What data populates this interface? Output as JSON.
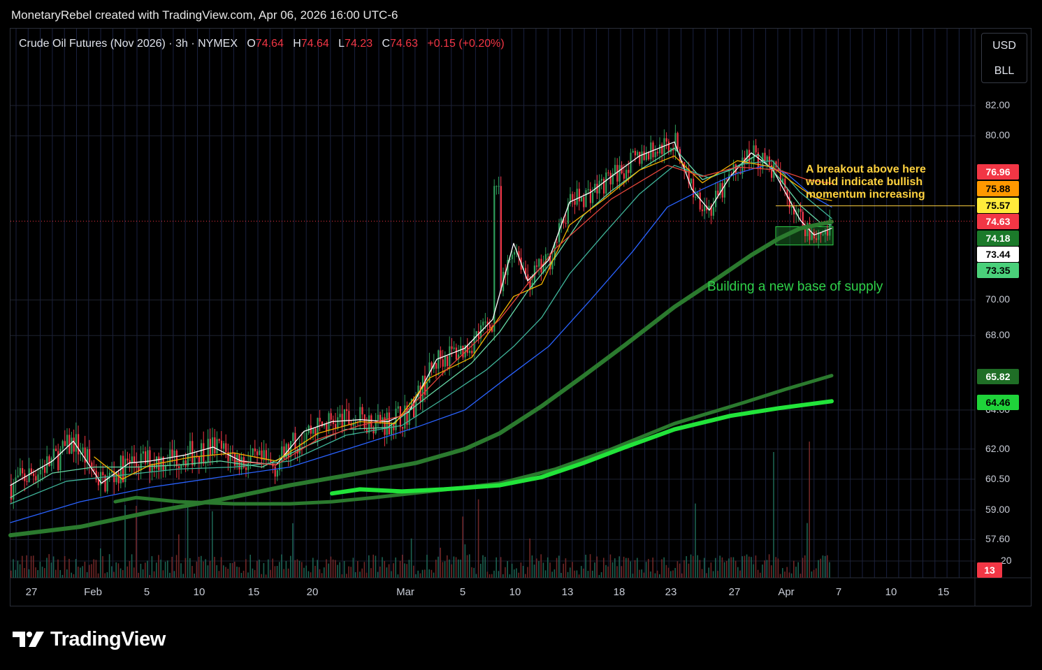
{
  "header": {
    "text": "MonetaryRebel created with TradingView.com, Apr 06, 2026 16:00 UTC-6"
  },
  "legend": {
    "symbol": "Crude Oil Futures (Nov 2026) · 3h · NYMEX",
    "open_label": "O",
    "open": "74.64",
    "high_label": "H",
    "high": "74.64",
    "low_label": "L",
    "low": "74.23",
    "close_label": "C",
    "close": "74.63",
    "change": "+0.15 (+0.20%)"
  },
  "currency": {
    "line1": "USD",
    "line2": "BLL"
  },
  "brand": {
    "name": "TradingView"
  },
  "annotations": {
    "breakout": [
      "A breakout above here",
      "would indicate bullish",
      "momentum increasing"
    ],
    "base": "Building a new base of supply"
  },
  "colors": {
    "background": "#000000",
    "up": "#2e9e5b",
    "down": "#f23645",
    "ema_white": "#ffffff",
    "ema_green_light": "#66d9a6",
    "ema_teal": "#3fb59a",
    "ema_blue": "#2962ff",
    "ema_yellow": "#f5b400",
    "ema_red": "#e4453a",
    "sma_dark_green": "#2b7a2e",
    "sma_bright_green": "#22e43a",
    "annotation_yellow": "#ffd23f",
    "annotation_green": "#2fd24a"
  },
  "chart_data": {
    "type": "candlestick",
    "y_axis": {
      "ticks": [
        "82.00",
        "80.00",
        "70.00",
        "68.00",
        "64.00",
        "62.00",
        "60.50",
        "59.00",
        "57.60",
        "20"
      ],
      "tick_values": [
        82.0,
        80.0,
        70.0,
        68.0,
        64.0,
        62.0,
        60.5,
        59.0,
        57.6,
        56.6
      ],
      "scale": "log"
    },
    "x_axis": {
      "labels": [
        "27",
        "Feb",
        "5",
        "10",
        "15",
        "20",
        "Mar",
        "5",
        "10",
        "13",
        "18",
        "23",
        "27",
        "Apr",
        "7",
        "10",
        "15"
      ]
    },
    "last_bar": {
      "open": 74.64,
      "high": 74.64,
      "low": 74.23,
      "close": 74.63,
      "change": 0.15,
      "change_pct": 0.2
    },
    "price_tags": [
      {
        "label": "76.96",
        "value": 76.96,
        "bg": "#f23645",
        "fg": "#ffffff"
      },
      {
        "label": "75.88",
        "value": 75.88,
        "bg": "#ff9800",
        "fg": "#000000"
      },
      {
        "label": "75.57",
        "value": 75.57,
        "bg": "#ffeb3b",
        "fg": "#000000"
      },
      {
        "label": "74.63",
        "value": 74.63,
        "bg": "#f23645",
        "fg": "#ffffff"
      },
      {
        "label": "74.18",
        "value": 74.18,
        "bg": "#1b7a2a",
        "fg": "#ffffff"
      },
      {
        "label": "73.44",
        "value": 73.44,
        "bg": "#ffffff",
        "fg": "#000000"
      },
      {
        "label": "73.35",
        "value": 73.35,
        "bg": "#4ad07a",
        "fg": "#000000"
      },
      {
        "label": "65.82",
        "value": 65.82,
        "bg": "#1f6e26",
        "fg": "#ffffff"
      },
      {
        "label": "64.46",
        "value": 64.46,
        "bg": "#1fd33a",
        "fg": "#000000"
      },
      {
        "label": "13",
        "value": 56.6,
        "bg": "#f23645",
        "fg": "#ffffff"
      }
    ],
    "breakout_level": 75.57,
    "base_zone": {
      "low": 73.2,
      "high": 74.3
    },
    "series": [
      {
        "name": "",
        "color": "#ffffff",
        "points": [
          [
            0,
            60.2
          ],
          [
            60,
            61.4
          ],
          [
            90,
            62.4
          ],
          [
            130,
            60.3
          ],
          [
            170,
            61.3
          ],
          [
            200,
            61.4
          ],
          [
            250,
            61.7
          ],
          [
            290,
            62.1
          ],
          [
            330,
            61.4
          ],
          [
            380,
            61.2
          ],
          [
            420,
            62.9
          ],
          [
            460,
            63.4
          ],
          [
            500,
            63.5
          ],
          [
            540,
            63.4
          ],
          [
            570,
            63.9
          ],
          [
            610,
            66.7
          ],
          [
            650,
            67.3
          ],
          [
            690,
            68.9
          ],
          [
            720,
            73.3
          ],
          [
            740,
            71.1
          ],
          [
            770,
            72.3
          ],
          [
            800,
            75.8
          ],
          [
            830,
            76.4
          ],
          [
            860,
            77.4
          ],
          [
            900,
            78.7
          ],
          [
            950,
            79.6
          ],
          [
            975,
            76.6
          ],
          [
            1000,
            75.3
          ],
          [
            1030,
            77.4
          ],
          [
            1060,
            78.9
          ],
          [
            1090,
            77.9
          ],
          [
            1110,
            76.3
          ],
          [
            1130,
            74.7
          ],
          [
            1150,
            73.8
          ],
          [
            1175,
            74.2
          ]
        ]
      },
      {
        "name": "",
        "color": "#66d9a6",
        "points": [
          [
            0,
            59.6
          ],
          [
            60,
            60.8
          ],
          [
            120,
            61.1
          ],
          [
            180,
            61.1
          ],
          [
            240,
            61.2
          ],
          [
            300,
            61.4
          ],
          [
            360,
            61.1
          ],
          [
            420,
            62.1
          ],
          [
            480,
            63.0
          ],
          [
            540,
            63.1
          ],
          [
            600,
            64.8
          ],
          [
            660,
            66.5
          ],
          [
            700,
            68.2
          ],
          [
            740,
            70.5
          ],
          [
            780,
            72.5
          ],
          [
            820,
            75.0
          ],
          [
            860,
            76.5
          ],
          [
            900,
            77.8
          ],
          [
            950,
            79.2
          ],
          [
            990,
            77.2
          ],
          [
            1030,
            77.8
          ],
          [
            1070,
            78.8
          ],
          [
            1100,
            77.3
          ],
          [
            1130,
            75.6
          ],
          [
            1160,
            74.5
          ],
          [
            1175,
            74.4
          ]
        ]
      },
      {
        "name": "",
        "color": "#3fb59a",
        "points": [
          [
            0,
            59.3
          ],
          [
            80,
            60.4
          ],
          [
            160,
            60.7
          ],
          [
            240,
            61.0
          ],
          [
            320,
            61.1
          ],
          [
            400,
            61.4
          ],
          [
            480,
            62.7
          ],
          [
            560,
            63.2
          ],
          [
            620,
            64.6
          ],
          [
            680,
            66.1
          ],
          [
            720,
            67.4
          ],
          [
            760,
            69.0
          ],
          [
            800,
            71.5
          ],
          [
            850,
            73.9
          ],
          [
            900,
            76.3
          ],
          [
            950,
            78.1
          ],
          [
            1000,
            77.3
          ],
          [
            1050,
            78.2
          ],
          [
            1090,
            78.4
          ],
          [
            1130,
            76.4
          ],
          [
            1175,
            74.8
          ]
        ]
      },
      {
        "name": "",
        "color": "#2962ff",
        "points": [
          [
            0,
            58.4
          ],
          [
            100,
            59.4
          ],
          [
            200,
            60.1
          ],
          [
            300,
            60.6
          ],
          [
            400,
            61.1
          ],
          [
            500,
            62.2
          ],
          [
            580,
            63.1
          ],
          [
            650,
            64.0
          ],
          [
            710,
            65.7
          ],
          [
            770,
            67.4
          ],
          [
            830,
            70.0
          ],
          [
            890,
            72.8
          ],
          [
            940,
            75.5
          ],
          [
            990,
            76.6
          ],
          [
            1040,
            77.6
          ],
          [
            1080,
            78.1
          ],
          [
            1110,
            77.6
          ],
          [
            1150,
            76.1
          ],
          [
            1175,
            75.5
          ]
        ]
      },
      {
        "name": "",
        "color": "#f5b400",
        "points": [
          [
            120,
            61.6
          ],
          [
            160,
            60.5
          ],
          [
            200,
            61.2
          ],
          [
            260,
            61.6
          ],
          [
            320,
            61.8
          ],
          [
            380,
            61.4
          ],
          [
            440,
            62.8
          ],
          [
            500,
            63.4
          ],
          [
            550,
            63.3
          ],
          [
            600,
            65.7
          ],
          [
            660,
            66.8
          ],
          [
            720,
            70.2
          ],
          [
            760,
            70.9
          ],
          [
            800,
            74.4
          ],
          [
            850,
            76.0
          ],
          [
            900,
            77.8
          ],
          [
            950,
            78.7
          ],
          [
            990,
            77.0
          ],
          [
            1040,
            78.4
          ],
          [
            1090,
            78.0
          ],
          [
            1120,
            77.0
          ],
          [
            1150,
            76.1
          ],
          [
            1175,
            75.9
          ]
        ]
      },
      {
        "name": "",
        "color": "#e4453a",
        "points": [
          [
            320,
            61.4
          ],
          [
            380,
            61.2
          ],
          [
            440,
            62.5
          ],
          [
            500,
            63.2
          ],
          [
            560,
            63.7
          ],
          [
            620,
            66.0
          ],
          [
            700,
            68.9
          ],
          [
            780,
            73.0
          ],
          [
            860,
            76.0
          ],
          [
            940,
            78.1
          ],
          [
            990,
            77.4
          ],
          [
            1040,
            78.0
          ],
          [
            1100,
            77.8
          ],
          [
            1140,
            77.2
          ],
          [
            1175,
            76.96
          ]
        ]
      },
      {
        "name": "",
        "color": "#2b7a2e",
        "width": 6,
        "points": [
          [
            0,
            57.8
          ],
          [
            100,
            58.2
          ],
          [
            200,
            58.9
          ],
          [
            300,
            59.5
          ],
          [
            400,
            60.2
          ],
          [
            500,
            60.8
          ],
          [
            580,
            61.3
          ],
          [
            650,
            62.0
          ],
          [
            700,
            62.8
          ],
          [
            760,
            64.2
          ],
          [
            820,
            65.8
          ],
          [
            880,
            67.5
          ],
          [
            950,
            69.6
          ],
          [
            1010,
            71.2
          ],
          [
            1060,
            72.6
          ],
          [
            1100,
            73.6
          ],
          [
            1130,
            74.2
          ],
          [
            1175,
            74.6
          ]
        ]
      },
      {
        "name": "",
        "color": "#2b7a2e",
        "width": 5,
        "points": [
          [
            150,
            59.4
          ],
          [
            180,
            59.6
          ],
          [
            240,
            59.4
          ],
          [
            320,
            59.3
          ],
          [
            400,
            59.3
          ],
          [
            460,
            59.4
          ],
          [
            520,
            59.6
          ],
          [
            600,
            59.9
          ],
          [
            700,
            60.3
          ],
          [
            780,
            61.0
          ],
          [
            860,
            62.0
          ],
          [
            950,
            63.3
          ],
          [
            1050,
            64.4
          ],
          [
            1110,
            65.1
          ],
          [
            1175,
            65.82
          ]
        ]
      },
      {
        "name": "",
        "color": "#22e43a",
        "width": 6,
        "points": [
          [
            460,
            59.8
          ],
          [
            500,
            60.0
          ],
          [
            560,
            59.9
          ],
          [
            620,
            60.0
          ],
          [
            700,
            60.2
          ],
          [
            760,
            60.6
          ],
          [
            820,
            61.3
          ],
          [
            880,
            62.1
          ],
          [
            950,
            63.0
          ],
          [
            1030,
            63.7
          ],
          [
            1100,
            64.1
          ],
          [
            1175,
            64.46
          ]
        ]
      }
    ]
  }
}
